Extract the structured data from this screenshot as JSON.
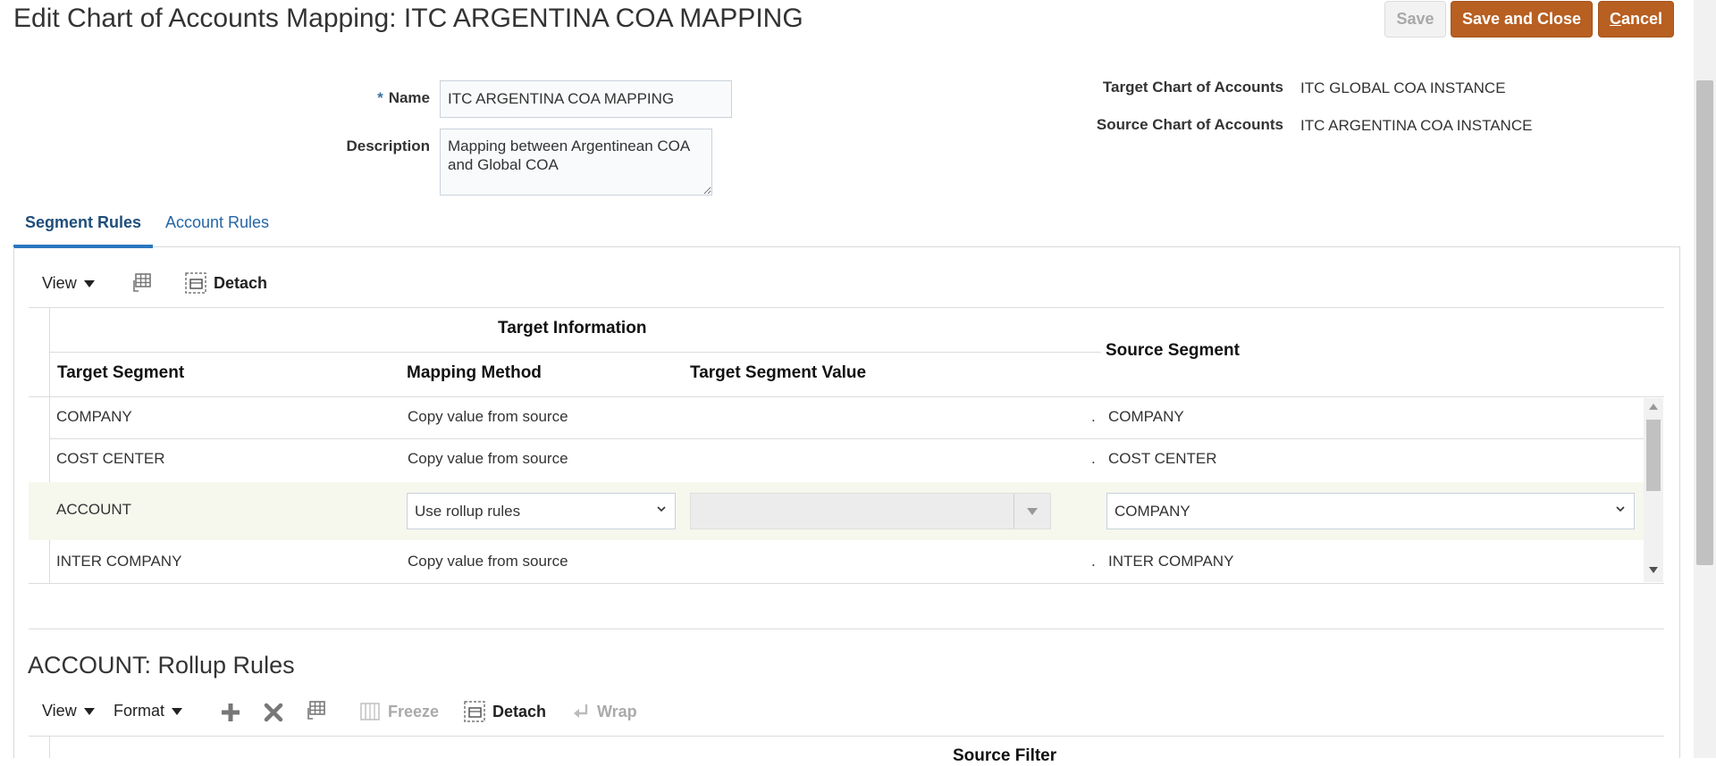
{
  "page": {
    "title": "Edit Chart of Accounts Mapping: ITC ARGENTINA COA MAPPING"
  },
  "actions": {
    "save": "Save",
    "save_and_close": "Save and Close",
    "cancel_first": "C",
    "cancel_rest": "ancel"
  },
  "form": {
    "required_mark": "*",
    "name_label": "Name",
    "name_value": "ITC ARGENTINA COA MAPPING",
    "description_label": "Description",
    "description_value": "Mapping between Argentinean COA and Global COA",
    "target_coa_label": "Target Chart of Accounts",
    "target_coa_value": "ITC GLOBAL COA INSTANCE",
    "source_coa_label": "Source Chart of Accounts",
    "source_coa_value": "ITC ARGENTINA COA INSTANCE"
  },
  "tabs": [
    {
      "label": "Segment Rules",
      "active": true
    },
    {
      "label": "Account Rules",
      "active": false
    }
  ],
  "segment_toolbar": {
    "view": "View",
    "detach": "Detach"
  },
  "segment_table": {
    "group_header": "Target Information",
    "columns": {
      "target_segment": "Target Segment",
      "mapping_method": "Mapping Method",
      "target_segment_value": "Target Segment Value",
      "source_segment": "Source Segment"
    },
    "rows": [
      {
        "target_segment": "COMPANY",
        "mapping_method": "Copy value from source",
        "target_value": "",
        "separator": ".",
        "source_segment": "COMPANY"
      },
      {
        "target_segment": "COST CENTER",
        "mapping_method": "Copy value from source",
        "target_value": "",
        "separator": ".",
        "source_segment": "COST CENTER"
      },
      {
        "target_segment": "ACCOUNT",
        "mapping_method": "Use rollup rules",
        "target_value": "",
        "separator": "",
        "source_segment": "COMPANY",
        "selected": true
      },
      {
        "target_segment": "INTER COMPANY",
        "mapping_method": "Copy value from source",
        "target_value": "",
        "separator": ".",
        "source_segment": "INTER COMPANY"
      }
    ]
  },
  "rollup": {
    "title": "ACCOUNT: Rollup Rules",
    "toolbar": {
      "view": "View",
      "format": "Format",
      "freeze": "Freeze",
      "detach": "Detach",
      "wrap": "Wrap"
    },
    "partial_header": "Source Filter"
  },
  "colors": {
    "accent_button": "#b85f22",
    "tab_underline": "#2a77c0",
    "selected_row": "#f6f7ed"
  }
}
